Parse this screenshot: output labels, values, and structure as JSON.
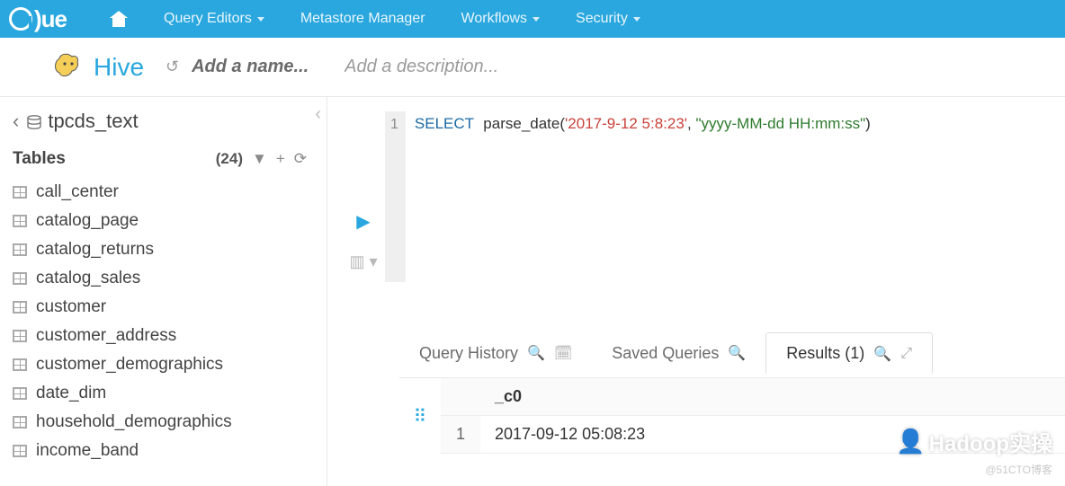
{
  "nav": {
    "items": [
      "Query Editors",
      "Metastore Manager",
      "Workflows",
      "Security"
    ],
    "dropdown": [
      true,
      false,
      true,
      true
    ]
  },
  "sub": {
    "engine": "Hive",
    "name_placeholder": "Add a name...",
    "desc_placeholder": "Add a description..."
  },
  "sidebar": {
    "database": "tpcds_text",
    "heading": "Tables",
    "count": "(24)",
    "tables": [
      "call_center",
      "catalog_page",
      "catalog_returns",
      "catalog_sales",
      "customer",
      "customer_address",
      "customer_demographics",
      "date_dim",
      "household_demographics",
      "income_band"
    ]
  },
  "editor": {
    "line_no": "1",
    "kw": "SELECT",
    "fn": "parse_date",
    "open": "(",
    "arg1": "'2017-9-12 5:8:23'",
    "comma": ", ",
    "arg2": "\"yyyy-MM-dd HH:mm:ss\"",
    "close": ")"
  },
  "tabs": {
    "history": "Query History",
    "saved": "Saved Queries",
    "results": "Results (1)"
  },
  "result": {
    "col": "_c0",
    "rownum": "1",
    "value": "2017-09-12 05:08:23"
  },
  "watermark": {
    "main": "Hadoop实操",
    "sub": "@51CTO博客"
  }
}
